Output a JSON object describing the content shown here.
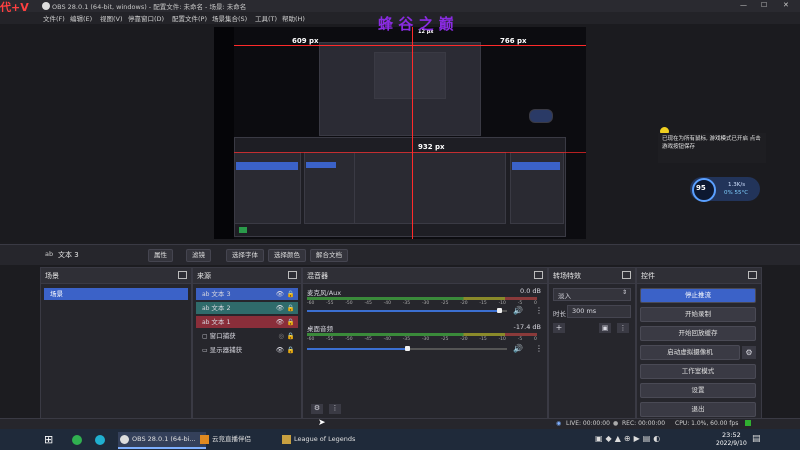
{
  "watermark_left": "代+V",
  "watermark_top": "蜂 谷 之 巅",
  "window": {
    "title": "OBS 28.0.1 (64-bit, windows) - 配置文件: 未命名 - 场景: 未命名"
  },
  "window_controls": {
    "minimize": "—",
    "maximize": "☐",
    "close": "✕"
  },
  "menu": [
    "文件(F)",
    "编辑(E)",
    "视图(V)",
    "停靠窗口(D)",
    "配置文件(P)",
    "场景集合(S)",
    "工具(T)",
    "帮助(H)"
  ],
  "preview": {
    "label_left": "609 px",
    "label_right": "766 px",
    "label_center": "932 px",
    "label_top": "12 px"
  },
  "notify": {
    "text": "已现在为所有鼠标, 游戏模式已开启 点击游戏按钮保存"
  },
  "overlay": {
    "fps": "95",
    "speed": "1.3K/s",
    "cpu": "0% 55°C"
  },
  "source_toolbar": {
    "name": "文本 3",
    "buttons": [
      "属性",
      "滤镜",
      "选择字体",
      "选择颜色",
      "解合文档"
    ]
  },
  "docks": {
    "scenes": {
      "title": "场景",
      "items": [
        "场景"
      ]
    },
    "sources": {
      "title": "来源",
      "items": [
        {
          "label": "文本 3",
          "color": "#3b5fc0"
        },
        {
          "label": "文本 2",
          "color": "#2f6b6b"
        },
        {
          "label": "文本 1",
          "color": "#8a2e3a"
        },
        {
          "label": "窗口捕获",
          "color": ""
        },
        {
          "label": "显示器捕获",
          "color": ""
        }
      ]
    },
    "mixer": {
      "title": "混音器",
      "channels": [
        {
          "name": "麦克风/Aux",
          "db": "0.0 dB",
          "level": 0.96
        },
        {
          "name": "桌面音频",
          "db": "-17.4 dB",
          "level": 0.5
        }
      ],
      "ticks": [
        "-60",
        "-55",
        "-50",
        "-45",
        "-40",
        "-35",
        "-30",
        "-25",
        "-20",
        "-15",
        "-10",
        "-5",
        "0"
      ]
    },
    "transitions": {
      "title": "转场特效",
      "type": "淡入",
      "duration_label": "时长",
      "duration": "300 ms"
    },
    "controls": {
      "title": "控件",
      "buttons": [
        "停止推流",
        "开始录制",
        "开始回放缓存",
        "启动虚拟摄像机",
        "工作室模式",
        "设置",
        "退出"
      ]
    }
  },
  "status": {
    "live": "LIVE: 00:00:00",
    "rec": "REC: 00:00:00",
    "cpu": "CPU: 1.0%, 60.00 fps"
  },
  "taskbar": {
    "apps": [
      "OBS 28.0.1 (64-bi...",
      "云竞直播伴侣",
      "League of Legends"
    ],
    "time": "23:52",
    "date": "2022/9/10"
  }
}
